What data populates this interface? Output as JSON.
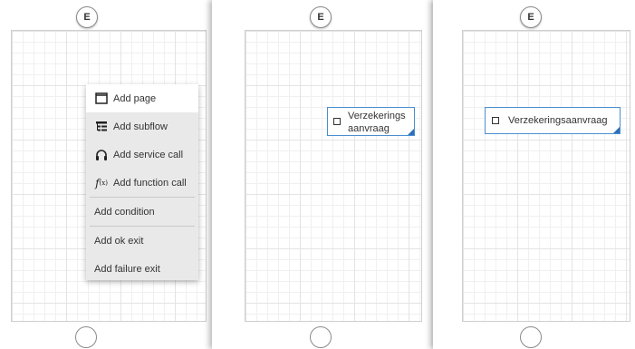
{
  "entry_label": "E",
  "context_menu": {
    "items": [
      {
        "label": "Add page",
        "icon": "page-icon"
      },
      {
        "label": "Add subflow",
        "icon": "subflow-icon"
      },
      {
        "label": "Add service call",
        "icon": "headset-icon"
      },
      {
        "label": "Add function call",
        "icon": "function-icon"
      },
      {
        "label": "Add condition"
      },
      {
        "label": "Add ok exit"
      },
      {
        "label": "Add failure exit"
      }
    ]
  },
  "node_wrapped": {
    "line1": "Verzekerings",
    "line2": "aanvraag"
  },
  "node_full": {
    "label": "Verzekeringsaanvraag"
  },
  "colors": {
    "node_border": "#4a8fd0",
    "node_corner": "#2d6fb8",
    "grid": "#e4e4e4"
  }
}
